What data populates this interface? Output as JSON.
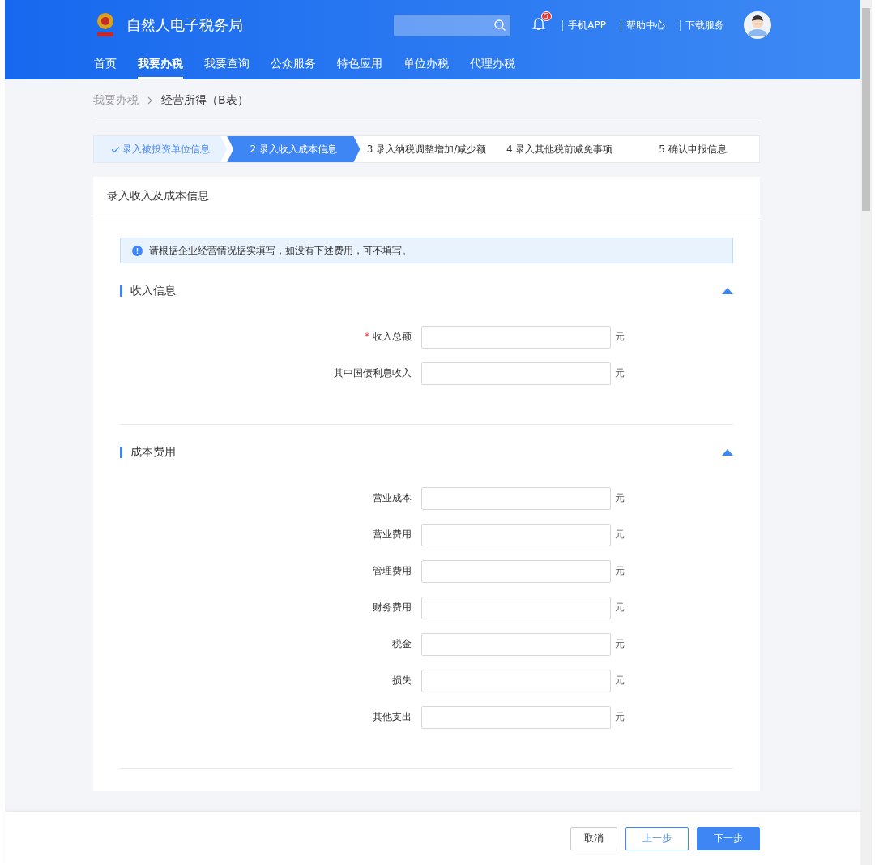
{
  "header": {
    "site_title": "自然人电子税务局",
    "notification_count": "5",
    "links": [
      "手机APP",
      "帮助中心",
      "下载服务"
    ]
  },
  "nav": [
    {
      "label": "首页",
      "selected": false
    },
    {
      "label": "我要办税",
      "selected": true
    },
    {
      "label": "我要查询",
      "selected": false
    },
    {
      "label": "公众服务",
      "selected": false
    },
    {
      "label": "特色应用",
      "selected": false
    },
    {
      "label": "单位办税",
      "selected": false
    },
    {
      "label": "代理办税",
      "selected": false
    }
  ],
  "breadcrumb": [
    "我要办税",
    "经营所得（B表）"
  ],
  "steps": [
    {
      "label": "录入被投资单位信息",
      "completed": true,
      "selected": false
    },
    {
      "label": "2 录入收入成本信息",
      "completed": false,
      "selected": true
    },
    {
      "label": "3 录入纳税调整增加/减少额",
      "completed": false,
      "selected": false
    },
    {
      "label": "4 录入其他税前减免事项",
      "completed": false,
      "selected": false
    },
    {
      "label": "5 确认申报信息",
      "completed": false,
      "selected": false
    }
  ],
  "card": {
    "title": "录入收入及成本信息",
    "notice": "请根据企业经营情况据实填写，如没有下述费用，可不填写。",
    "sections": [
      {
        "title": "收入信息",
        "expanded": true,
        "fields": [
          {
            "label": "收入总额",
            "required_mark": "*",
            "unit": "元"
          },
          {
            "label": "其中国债利息收入",
            "unit": "元"
          }
        ]
      },
      {
        "title": "成本费用",
        "expanded": true,
        "fields": [
          {
            "label": "营业成本",
            "unit": "元"
          },
          {
            "label": "营业费用",
            "unit": "元"
          },
          {
            "label": "管理费用",
            "unit": "元"
          },
          {
            "label": "财务费用",
            "unit": "元"
          },
          {
            "label": "税金",
            "unit": "元"
          },
          {
            "label": "损失",
            "unit": "元"
          },
          {
            "label": "其他支出",
            "unit": "元"
          }
        ]
      }
    ]
  },
  "footer": {
    "buttons": [
      {
        "label": "取消",
        "kind": "default"
      },
      {
        "label": "上一步",
        "kind": "outline"
      },
      {
        "label": "下一步",
        "kind": "primary"
      }
    ]
  }
}
